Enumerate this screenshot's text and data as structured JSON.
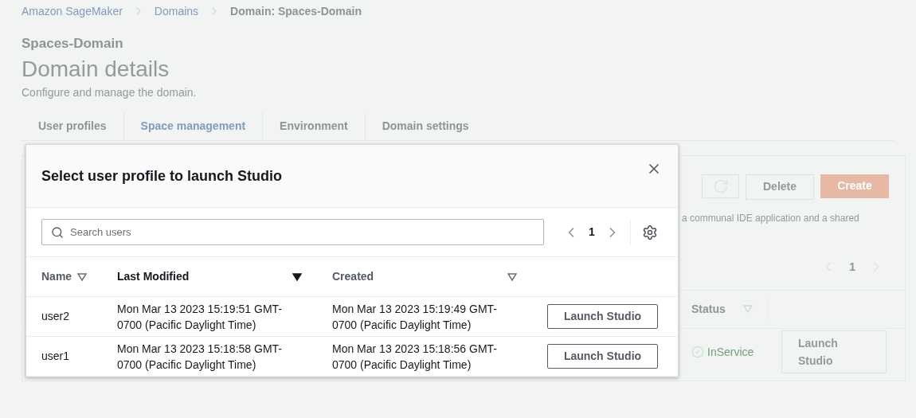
{
  "breadcrumbs": [
    {
      "label": "Amazon SageMaker",
      "link": true
    },
    {
      "label": "Domains",
      "link": true
    },
    {
      "label": "Domain: Spaces-Domain",
      "link": false
    }
  ],
  "page": {
    "domain_name": "Spaces-Domain",
    "title": "Domain details",
    "subtitle": "Configure and manage the domain."
  },
  "tabs": [
    {
      "label": "User profiles",
      "selected": false
    },
    {
      "label": "Space management",
      "selected": true
    },
    {
      "label": "Environment",
      "selected": false
    },
    {
      "label": "Domain settings",
      "selected": false
    }
  ],
  "space_card": {
    "buttons": [
      "Delete",
      "Create"
    ],
    "description": "a communal IDE application and a shared",
    "page": "1",
    "columns": [
      "Status"
    ],
    "rows": [
      {
        "status": "InService",
        "action": "Launch Studio"
      }
    ]
  },
  "modal": {
    "title": "Select user profile to launch Studio",
    "search": {
      "placeholder": "Search users"
    },
    "page": "1",
    "columns": [
      {
        "label": "Name",
        "sorted": false
      },
      {
        "label": "Last Modified",
        "sorted": true
      },
      {
        "label": "Created",
        "sorted": false
      }
    ],
    "rows": [
      {
        "name": "user2",
        "last_modified": "Mon Mar 13 2023 15:19:51 GMT-0700 (Pacific Daylight Time)",
        "created": "Mon Mar 13 2023 15:19:49 GMT-0700 (Pacific Daylight Time)",
        "action": "Launch Studio"
      },
      {
        "name": "user1",
        "last_modified": "Mon Mar 13 2023 15:18:58 GMT-0700 (Pacific Daylight Time)",
        "created": "Mon Mar 13 2023 15:18:56 GMT-0700 (Pacific Daylight Time)",
        "action": "Launch Studio"
      }
    ]
  }
}
